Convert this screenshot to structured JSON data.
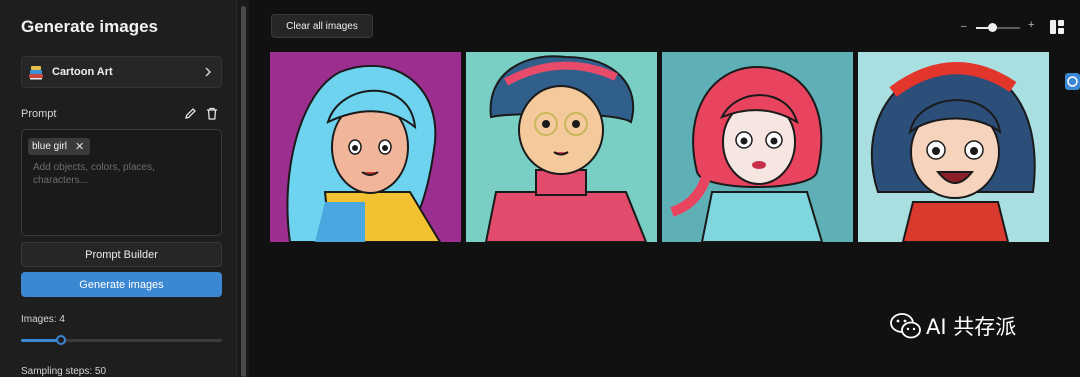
{
  "sidebar": {
    "title": "Generate images",
    "style_selector": {
      "name": "Cartoon Art",
      "thumb_icon": "books-icon"
    },
    "prompt": {
      "label": "Prompt",
      "chip": "blue girl",
      "chip_remove": "✕",
      "placeholder": "Add objects, colors, places, characters..."
    },
    "prompt_builder_label": "Prompt Builder",
    "generate_label": "Generate images",
    "images_slider": {
      "label": "Images: 4",
      "value": 4,
      "fraction": 0.2
    },
    "sampling_steps_label": "Sampling steps: 50"
  },
  "main": {
    "clear_label": "Clear all images",
    "zoom": {
      "minus": "–",
      "plus": "+",
      "fraction": 0.35
    },
    "images": [
      {
        "description": "cartoon girl with light blue hair on purple background"
      },
      {
        "description": "cartoon girl with glasses and teal hair on teal background"
      },
      {
        "description": "cartoon girl with red ponytails on blue background"
      },
      {
        "description": "cartoon girl with dark hair and red headband laughing"
      }
    ]
  },
  "watermark": {
    "text": "AI 共存派",
    "icon": "wechat-icon"
  },
  "colors": {
    "accent": "#3b87d1",
    "panel": "#1e1e1f",
    "background": "#111111"
  }
}
